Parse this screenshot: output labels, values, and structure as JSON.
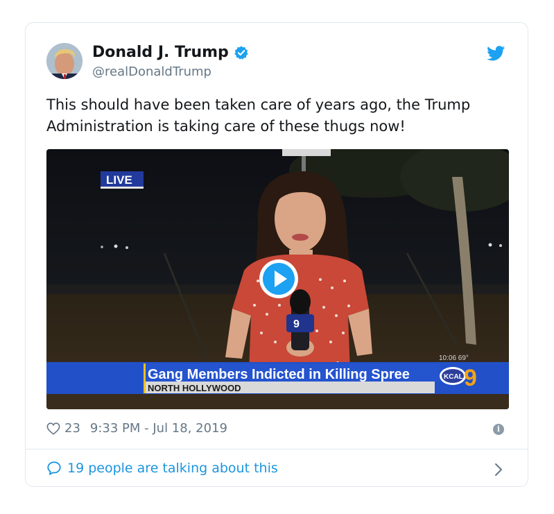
{
  "author": {
    "name": "Donald J. Trump",
    "handle": "@realDonaldTrump"
  },
  "tweet": {
    "text": "This should have been taken care of years ago, the Trump Administration is taking care of these thugs now!"
  },
  "video": {
    "live_label": "LIVE",
    "headline": "Gang Members Indicted in Killing Spree",
    "location": "NORTH HOLLYWOOD",
    "clock": "10:06  69°",
    "station_logo_text": "KCAL",
    "station_number": "9",
    "mic_flag_text": "9"
  },
  "footer": {
    "like_count": "23",
    "timestamp": "9:33 PM - Jul 18, 2019"
  },
  "conversation": {
    "label": "19 people are talking about this"
  },
  "icons": {
    "verified": "verified-badge-icon",
    "bird": "twitter-bird-icon",
    "heart": "heart-icon",
    "info": "info-icon",
    "comment": "comment-bubble-icon",
    "chevron": "chevron-right-icon",
    "play": "play-icon"
  },
  "colors": {
    "brand_blue": "#1da1f2",
    "link_blue": "#1b95e0",
    "chyron_blue": "#1f4fc0",
    "text_primary": "#14171a",
    "text_secondary": "#657786"
  }
}
